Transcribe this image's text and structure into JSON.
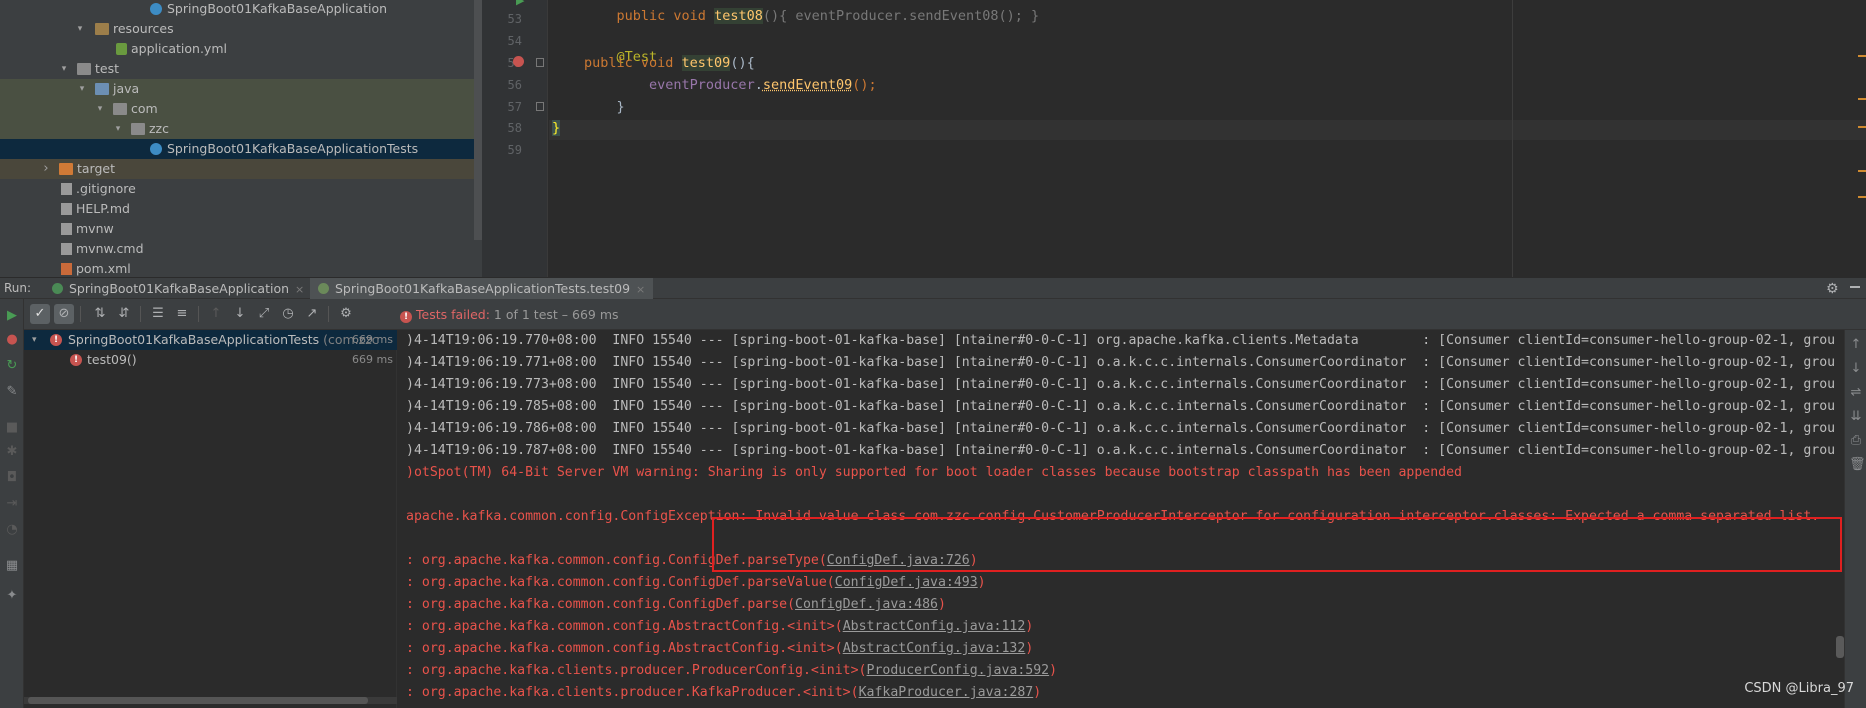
{
  "project_tree": {
    "items": [
      {
        "label": "SpringBoot01KafkaBaseApplication",
        "type": "class"
      },
      {
        "label": "resources",
        "type": "folder-res",
        "arrow": "▾"
      },
      {
        "label": "application.yml",
        "type": "yml"
      },
      {
        "label": "test",
        "type": "folder",
        "arrow": "▾"
      },
      {
        "label": "java",
        "type": "folder-src",
        "arrow": "▾"
      },
      {
        "label": "com",
        "type": "folder",
        "arrow": "▾"
      },
      {
        "label": "zzc",
        "type": "folder",
        "arrow": "▾"
      },
      {
        "label": "SpringBoot01KafkaBaseApplicationTests",
        "type": "class"
      },
      {
        "label": "target",
        "type": "folder-target",
        "arrow": "›"
      },
      {
        "label": ".gitignore",
        "type": "file"
      },
      {
        "label": "HELP.md",
        "type": "file"
      },
      {
        "label": "mvnw",
        "type": "file"
      },
      {
        "label": "mvnw.cmd",
        "type": "file"
      },
      {
        "label": "pom.xml",
        "type": "file"
      }
    ]
  },
  "editor": {
    "line_numbers": [
      "53",
      "54",
      "55",
      "56",
      "57",
      "58",
      "59"
    ],
    "line_top_partial": {
      "kw": "public void ",
      "fn": "test08",
      "rest": "(){ eventProducer.sendEvent08(); }"
    },
    "code": {
      "annotation": "@Test",
      "kw_public": "public ",
      "kw_void": "void ",
      "method_name": "test09",
      "after_method": "(){",
      "indent2": "        ",
      "field": "eventProducer",
      "dot": ".",
      "call": "sendEvent09",
      "call_end": "();",
      "close_inner": "    }",
      "close_outer": "}"
    }
  },
  "run": {
    "label": "Run:",
    "tabs": [
      {
        "label": "SpringBoot01KafkaBaseApplication",
        "close": "×"
      },
      {
        "label": "SpringBoot01KafkaBaseApplicationTests.test09",
        "close": "×"
      }
    ],
    "status": {
      "failed": "Tests failed:",
      "detail": " 1 of 1 test – 669 ms"
    },
    "test_tree": {
      "root": {
        "name": "SpringBoot01KafkaBaseApplicationTests",
        "pkg": " (com.zzc",
        "duration": "669 ms"
      },
      "child": {
        "name": "test09()",
        "duration": "669 ms"
      }
    },
    "console": {
      "info_lines": [
        ")4-14T19:06:19.770+08:00  INFO 15540 --- [spring-boot-01-kafka-base] [ntainer#0-0-C-1] org.apache.kafka.clients.Metadata        : [Consumer clientId=consumer-hello-group-02-1, grou",
        ")4-14T19:06:19.771+08:00  INFO 15540 --- [spring-boot-01-kafka-base] [ntainer#0-0-C-1] o.a.k.c.c.internals.ConsumerCoordinator  : [Consumer clientId=consumer-hello-group-02-1, grou",
        ")4-14T19:06:19.773+08:00  INFO 15540 --- [spring-boot-01-kafka-base] [ntainer#0-0-C-1] o.a.k.c.c.internals.ConsumerCoordinator  : [Consumer clientId=consumer-hello-group-02-1, grou",
        ")4-14T19:06:19.785+08:00  INFO 15540 --- [spring-boot-01-kafka-base] [ntainer#0-0-C-1] o.a.k.c.c.internals.ConsumerCoordinator  : [Consumer clientId=consumer-hello-group-02-1, grou",
        ")4-14T19:06:19.786+08:00  INFO 15540 --- [spring-boot-01-kafka-base] [ntainer#0-0-C-1] o.a.k.c.c.internals.ConsumerCoordinator  : [Consumer clientId=consumer-hello-group-02-1, grou",
        ")4-14T19:06:19.787+08:00  INFO 15540 --- [spring-boot-01-kafka-base] [ntainer#0-0-C-1] o.a.k.c.c.internals.ConsumerCoordinator  : [Consumer clientId=consumer-hello-group-02-1, grou"
      ],
      "warning": ")otSpot(TM) 64-Bit Server VM warning: Sharing is only supported for boot loader classes because bootstrap classpath has been appended",
      "exception": "apache.kafka.common.config.ConfigException: Invalid value class com.zzc.config.CustomerProducerInterceptor for configuration interceptor.classes: Expected a comma separated list.",
      "stack": [
        {
          "prefix": ": org.apache.kafka.common.config.ConfigDef.parseType(",
          "link": "ConfigDef.java:726",
          "suffix": ")"
        },
        {
          "prefix": ": org.apache.kafka.common.config.ConfigDef.parseValue(",
          "link": "ConfigDef.java:493",
          "suffix": ")"
        },
        {
          "prefix": ": org.apache.kafka.common.config.ConfigDef.parse(",
          "link": "ConfigDef.java:486",
          "suffix": ")"
        },
        {
          "prefix": ": org.apache.kafka.common.config.AbstractConfig.<init>(",
          "link": "AbstractConfig.java:112",
          "suffix": ")"
        },
        {
          "prefix": ": org.apache.kafka.common.config.AbstractConfig.<init>(",
          "link": "AbstractConfig.java:132",
          "suffix": ")"
        },
        {
          "prefix": ": org.apache.kafka.clients.producer.ProducerConfig.<init>(",
          "link": "ProducerConfig.java:592",
          "suffix": ")"
        },
        {
          "prefix": ": org.apache.kafka.clients.producer.KafkaProducer.<init>(",
          "link": "KafkaProducer.java:287",
          "suffix": ")"
        }
      ]
    }
  },
  "watermark": "CSDN @Libra_97",
  "colors": {
    "error": "#e8534b",
    "highlight_box": "#e02020",
    "keyword": "#cc7832",
    "annotation": "#bbb529",
    "selection": "#0d293e"
  }
}
